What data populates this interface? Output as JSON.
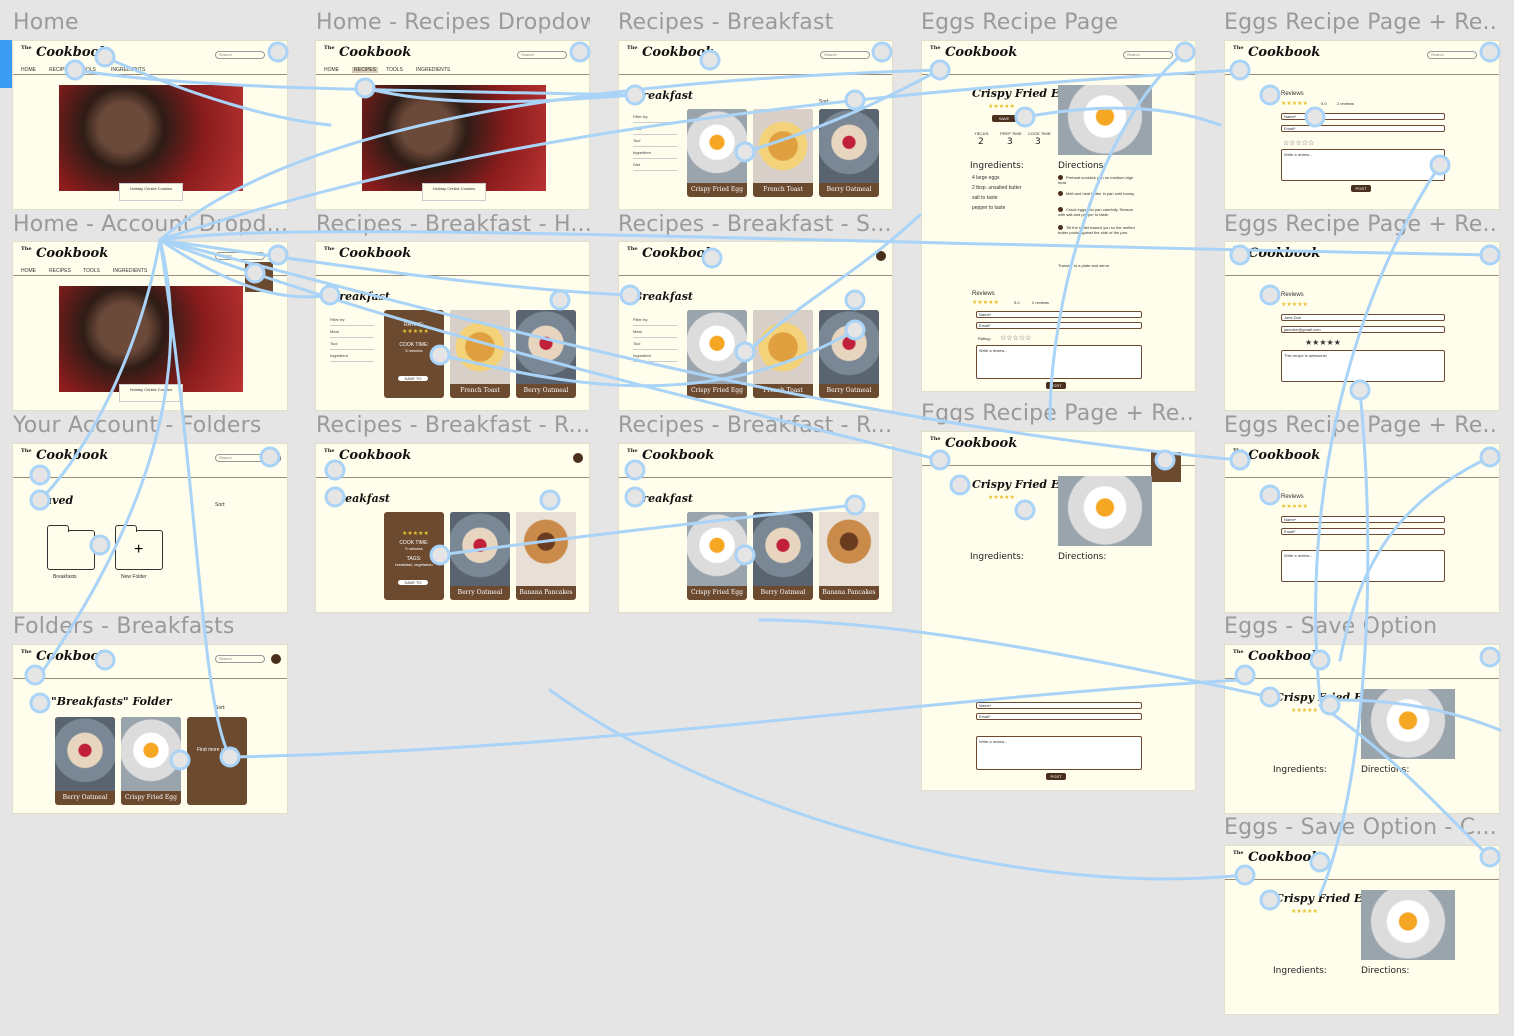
{
  "frames": {
    "home": {
      "title": "Home",
      "nav": [
        "HOME",
        "RECIPES",
        "TOOLS",
        "INGREDIENTS"
      ],
      "hero_caption": "Holiday Crinkle Cookies"
    },
    "home_recipes_dropdown": {
      "title": "Home - Recipes Dropdown",
      "nav": [
        "HOME",
        "RECIPES",
        "TOOLS",
        "INGREDIENTS"
      ],
      "hero_caption": "Holiday Crinkle Cookies"
    },
    "recipes_breakfast": {
      "title": "Recipes - Breakfast",
      "heading": "Breakfast",
      "filter_label": "Filter by:",
      "filters": [
        "Meal",
        "Tool",
        "Ingredient",
        "Diet"
      ],
      "sort_label": "Sort:",
      "cards": [
        "Crispy Fried Egg",
        "French Toast",
        "Berry Oatmeal"
      ]
    },
    "eggs_recipe_page": {
      "title": "Eggs Recipe Page",
      "recipe_title": "Crispy Fried Eggs",
      "save_label": "SAVE",
      "stats": [
        {
          "label": "YIELDS:",
          "value": "2",
          "unit": "servings"
        },
        {
          "label": "PREP TIME:",
          "value": "3",
          "unit": "minutes"
        },
        {
          "label": "COOK TIME:",
          "value": "3",
          "unit": "minutes"
        }
      ],
      "ingredients_heading": "Ingredients:",
      "ingredients": [
        "4 large eggs",
        "2 tbsp. unsalted butter",
        "salt to taste",
        "pepper to taste"
      ],
      "directions_heading": "Directions:",
      "directions": [
        "Preheat nonstick pan on medium-high heat.",
        "Melt and heat butter in pan until foamy.",
        "Crack eggs into pan carefully. Season with salt and pepper to taste.",
        "Tilt the skillet toward you so the melted butter pools against the side of the pan.",
        "Transfer to a plate and serve."
      ],
      "reviews_heading": "Reviews",
      "rating_value": "5.0",
      "reviews_count": "2 reviews",
      "name_placeholder": "Name*",
      "email_placeholder": "Email*",
      "rating_label": "Rating:",
      "review_placeholder": "Write a review...",
      "post_label": "POST"
    },
    "eggs_recipe_review_1": {
      "title": "Eggs Recipe Page + Re...",
      "reviews_heading": "Reviews",
      "rating_value": "5.0",
      "reviews_count": "2 reviews",
      "post_label": "POST"
    },
    "home_account_dropdown": {
      "title": "Home - Account Dropd...",
      "nav": [
        "HOME",
        "RECIPES",
        "TOOLS",
        "INGREDIENTS"
      ],
      "hero_caption": "Holiday Crinkle Cookies"
    },
    "recipes_breakfast_h": {
      "title": "Recipes - Breakfast - H...",
      "heading": "Breakfast",
      "hover_rating": "RATING:",
      "hover_cook_time": "COOK TIME:",
      "hover_cook_value": "5 minutes",
      "hover_save": "SAVE TO",
      "cards": [
        "Crispy Fried Egg",
        "French Toast",
        "Berry Oatmeal"
      ]
    },
    "recipes_breakfast_s": {
      "title": "Recipes - Breakfast - S...",
      "heading": "Breakfast",
      "cards": [
        "Crispy Fried Egg",
        "French Toast",
        "Berry Oatmeal"
      ]
    },
    "eggs_recipe_review_2": {
      "title": "Eggs Recipe Page + Re...",
      "reviews_heading": "Reviews",
      "reviewer_name": "Jane Doe",
      "reviewer_email": "janedoe@gmail.com",
      "review_text": "This recipe is awesome!"
    },
    "your_account_folders": {
      "title": "Your Account - Folders",
      "heading": "Saved",
      "sort_label": "Sort:",
      "folders": [
        "Breakfasts",
        "New Folder"
      ]
    },
    "recipes_breakfast_r1": {
      "title": "Recipes - Breakfast - R...",
      "heading": "Breakfast",
      "hover_cook_time": "COOK TIME:",
      "hover_cook_value": "5 minutes",
      "hover_tags": "TAGS:",
      "hover_tags_value": "breakfast, vegetarian",
      "hover_save": "SAVE TO",
      "cards": [
        "Crispy Fried Egg",
        "Berry Oatmeal",
        "Banana Pancakes"
      ]
    },
    "recipes_breakfast_r2": {
      "title": "Recipes - Breakfast - R...",
      "heading": "Breakfast",
      "cards": [
        "Crispy Fried Egg",
        "Berry Oatmeal",
        "Banana Pancakes"
      ]
    },
    "eggs_recipe_review_3": {
      "title": "Eggs Recipe Page + Re...",
      "recipe_title": "Crispy Fried Eggs",
      "ingredients_heading": "Ingredients:",
      "directions_heading": "Directions:",
      "post_label": "POST"
    },
    "eggs_recipe_review_4": {
      "title": "Eggs Recipe Page + Re...",
      "reviews_heading": "Reviews",
      "rating_value": "5.0",
      "reviews_count": "2 reviews"
    },
    "folders_breakfasts": {
      "title": "Folders - Breakfasts",
      "heading": "\"Breakfasts\" Folder",
      "sort_label": "Sort:",
      "cards": [
        "Berry Oatmeal",
        "Crispy Fried Egg"
      ],
      "extra_card": "Find more recipes"
    },
    "eggs_save_option": {
      "title": "Eggs - Save Option",
      "recipe_title": "Crispy Fried Eggs",
      "ingredients_heading": "Ingredients:",
      "directions_heading": "Directions:"
    },
    "eggs_save_option_c": {
      "title": "Eggs - Save Option - C...",
      "recipe_title": "Crispy Fried Eggs",
      "ingredients_heading": "Ingredients:",
      "directions_heading": "Directions:"
    }
  },
  "logo": {
    "small": "The",
    "main": "Cookbook"
  },
  "search_placeholder": "Search",
  "colors": {
    "canvas": "#e5e5e5",
    "frame": "#fffdec",
    "brown": "#6b4a30",
    "wire": "#a9d3f7",
    "accent": "#3a9cf3",
    "star": "#e8c22e"
  }
}
